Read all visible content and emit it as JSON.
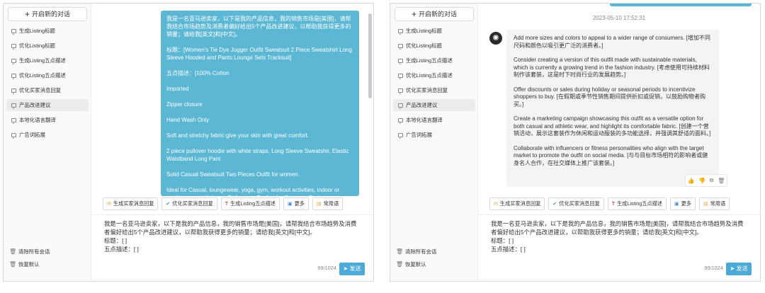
{
  "sidebar": {
    "new_chat_label": "开启新的对话",
    "items": [
      {
        "label": "生成Listing标题"
      },
      {
        "label": "优化Listing标题"
      },
      {
        "label": "生成Listing五点描述"
      },
      {
        "label": "优化Listing五点描述"
      },
      {
        "label": "优化买家消息回复"
      },
      {
        "label": "产品改进建议"
      },
      {
        "label": "本地化语言翻译"
      },
      {
        "label": "广告词拓展"
      }
    ],
    "clear_all_label": "清除所有会话",
    "restore_default_label": "恢复默认"
  },
  "left_chat": {
    "user_message": [
      "我是一名亚马逊卖家，以下是我的产品信息，我的销售市场是[美国]，请帮我结合市场趋势及消费者偏好给出5个产品改进建议，以帮助我获得更多的销量；请给我[英文]和[中文]。",
      "标题：[Women's Tie Dye Jogger Outfit Sweatsuit 2 Piece Sweatshirt Long Sleeve Hooded and Pants Lounge Sets Tracksuit]",
      "五点描述：[100% Cotton",
      "Imported",
      "Zipper closure",
      "Hand Wash Only",
      "Soft and stretchy fabric give your skin with great comfort.",
      "2 piece pullover hoodie with white straps,  Long Sleeve Sweatshir, Elastic Waistband Long Pant",
      "Solid Casual Sweatsuit Two Pieces Outfit for women.",
      "Ideal for Casual, loungewear, yoga, gym, workout activities, indoor or outdoor sports, Leisure, Daily wear. Perfect for Summer, Spring,"
    ]
  },
  "right_chat": {
    "timestamp": "2023-05-10 17:52:31",
    "bot_message": [
      "Add more sizes and colors to appeal to a wider range of consumers. [增加不同尺码和颜色以吸引更广泛的消费者。]",
      "Consider creating a version of this outfit made with sustainable materials, which is currently a growing trend in the fashion industry. [考虑使用可持续材料制作该套装，这是时下时尚行业的发展趋势。]",
      "Offer discounts or sales during holiday or seasonal periods to incentivize shoppers to buy. [在假期或季节性销售期间提供折扣或促销，以鼓励购物者购买。]",
      "Create a marketing campaign showcasing this outfit as a versatile option for both casual and athletic wear, and highlight its comfortable fabric. [创建一个营销活动，展示这套装作为休闲和运动服装的多功能选择，并强调其舒适的面料。]",
      "Collaborate with influencers or fitness personalities who align with the target market to promote the outfit on social media. [与与目标市场相符的影响者或健身名人合作，在社交媒体上推广该套装。]"
    ]
  },
  "quick_actions": [
    {
      "label": "生成买家消息回复",
      "icon": "message-icon",
      "glyph": "✉"
    },
    {
      "label": "优化买家消息回复",
      "icon": "check-icon",
      "glyph": "✔"
    },
    {
      "label": "生成Listing五点描述",
      "icon": "text-icon",
      "glyph": "T"
    },
    {
      "label": "更多",
      "icon": "cube-icon",
      "glyph": "▣"
    },
    {
      "label": "常用语",
      "icon": "note-icon",
      "glyph": "▤"
    }
  ],
  "input": {
    "lines": [
      "我是一名亚马逊卖家，以下是我的产品信息，我的销售市场是[美国]，请帮我结合市场趋势及消费者偏好给出5个产品改进建议，以帮助我获得更多的销量；请给我[英文]和[中文]。",
      "标题：[ ]",
      "五点描述：[ ]"
    ],
    "char_count": "99/1024",
    "send_label": "发送"
  }
}
